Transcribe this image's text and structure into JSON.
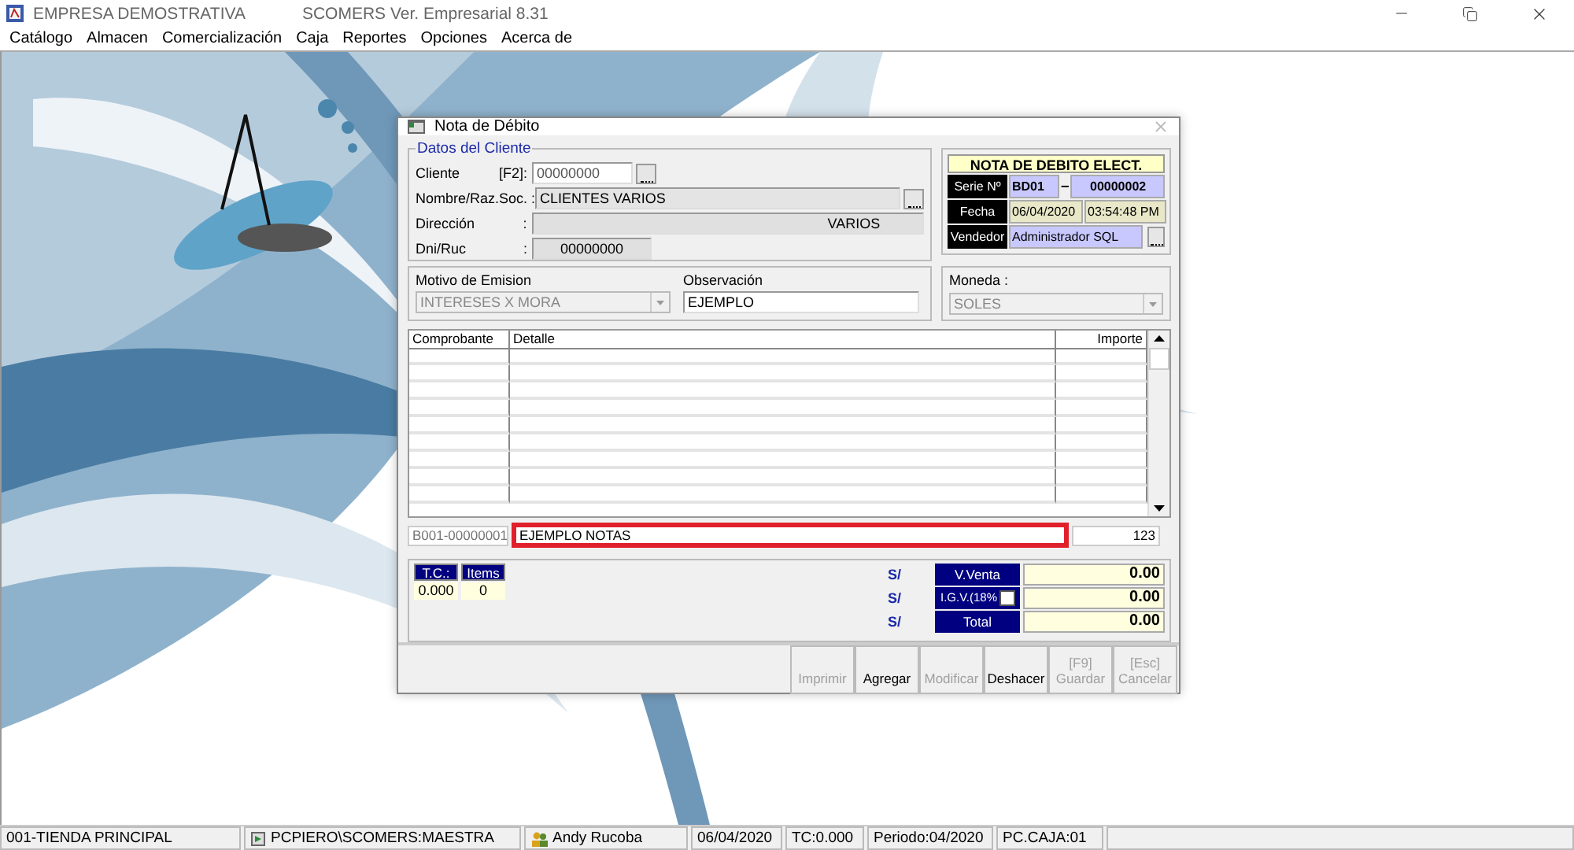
{
  "app": {
    "title": "EMPRESA DEMOSTRATIVA",
    "version": "SCOMERS Ver. Empresarial  8.31"
  },
  "menu": [
    "Catálogo",
    "Almacen",
    "Comercialización",
    "Caja",
    "Reportes",
    "Opciones",
    "Acerca de"
  ],
  "dialog": {
    "title": "Nota de Débito",
    "client": {
      "legend": "Datos del Cliente",
      "fields": [
        {
          "label": "Cliente",
          "hint": "[F2]:",
          "value": "00000000",
          "kind": "code"
        },
        {
          "label": "Nombre/Raz.Soc. :",
          "value": "CLIENTES VARIOS",
          "kind": "wide"
        },
        {
          "label": "Dirección",
          "hint": ":",
          "value": "VARIOS",
          "kind": "address"
        },
        {
          "label": "Dni/Ruc",
          "hint": ":",
          "value": "00000000",
          "kind": "doc"
        }
      ]
    },
    "document": {
      "title": "NOTA DE DEBITO ELECT.",
      "serie_label": "Serie Nº",
      "serie": "BD01",
      "dash": "–",
      "number": "00000002",
      "fecha_label": "Fecha",
      "date": "06/04/2020",
      "time": "03:54:48 PM",
      "vendedor_label": "Vendedor",
      "vendedor": "Administrador SQL"
    },
    "motivo": {
      "label": "Motivo de Emision",
      "value": "INTERESES X MORA"
    },
    "observacion": {
      "label": "Observación",
      "value": "EJEMPLO"
    },
    "moneda": {
      "label": "Moneda :",
      "value": "SOLES"
    },
    "table": {
      "columns": [
        "Comprobante",
        "Detalle",
        "Importe"
      ]
    },
    "entry": {
      "comprobante": "B001-00000001",
      "detalle": "EJEMPLO NOTAS",
      "importe": "123",
      "highlighted": true
    },
    "summary": {
      "tc_label": "T.C.:",
      "tc": "0.000",
      "items_label": "Items",
      "items": "0",
      "totals": [
        {
          "currency": "S/",
          "label": "V.Venta",
          "value": "0.00"
        },
        {
          "currency": "S/",
          "label": "I.G.V.(18%",
          "value": "0.00",
          "checked": false
        },
        {
          "currency": "S/",
          "label": "Total",
          "value": "0.00"
        }
      ]
    },
    "buttons": [
      {
        "label": "Imprimir",
        "disabled": true
      },
      {
        "label": "Agregar",
        "disabled": false
      },
      {
        "label": "Modificar",
        "disabled": true
      },
      {
        "label": "Deshacer",
        "disabled": false
      },
      {
        "key": "[F9]",
        "label": "Guardar",
        "disabled": true
      },
      {
        "key": "[Esc]",
        "label": "Cancelar",
        "disabled": true
      }
    ]
  },
  "status_bar": [
    {
      "text": "001-TIENDA PRINCIPAL",
      "kind": "plain"
    },
    {
      "text": "PCPIERO\\SCOMERS:MAESTRA",
      "kind": "database"
    },
    {
      "text": "Andy Rucoba",
      "kind": "user"
    },
    {
      "text": "06/04/2020",
      "kind": "plain"
    },
    {
      "text": "TC:0.000",
      "kind": "plain"
    },
    {
      "text": "Periodo:04/2020",
      "kind": "plain"
    },
    {
      "text": "PC.CAJA:01",
      "kind": "plain"
    }
  ]
}
